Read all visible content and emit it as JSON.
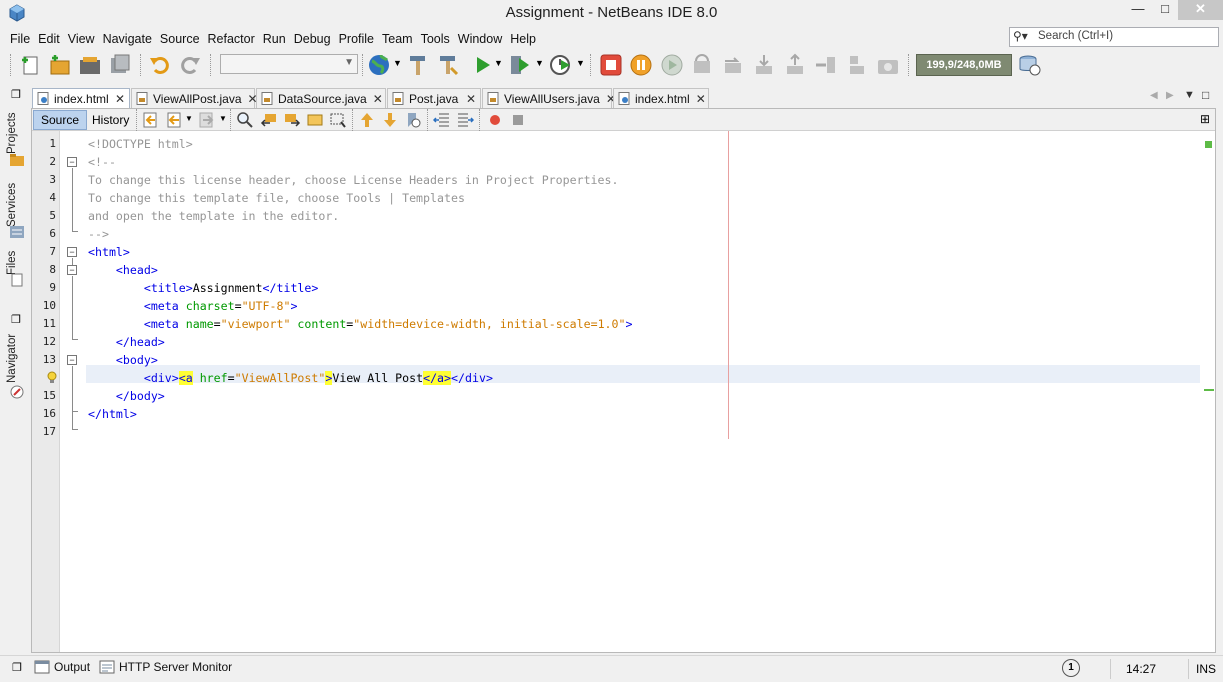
{
  "window": {
    "title": "Assignment - NetBeans IDE 8.0"
  },
  "menu": [
    "File",
    "Edit",
    "View",
    "Navigate",
    "Source",
    "Refactor",
    "Run",
    "Debug",
    "Profile",
    "Team",
    "Tools",
    "Window",
    "Help"
  ],
  "search": {
    "placeholder": "Search (Ctrl+I)"
  },
  "toolbar": {
    "memory": "199,9/248,0MB"
  },
  "sidebar": [
    "Projects",
    "Services",
    "Files",
    "Navigator"
  ],
  "tabs": [
    {
      "label": "index.html",
      "active": true
    },
    {
      "label": "ViewAllPost.java"
    },
    {
      "label": "DataSource.java"
    },
    {
      "label": "Post.java"
    },
    {
      "label": "ViewAllUsers.java"
    },
    {
      "label": "index.html"
    }
  ],
  "editor": {
    "source_label": "Source",
    "history_label": "History",
    "line_numbers": [
      "1",
      "2",
      "3",
      "4",
      "5",
      "6",
      "7",
      "8",
      "9",
      "10",
      "11",
      "12",
      "13",
      "14",
      "15",
      "16",
      "17"
    ],
    "lines": [
      "<!DOCTYPE html>",
      "<!--",
      "To change this license header, choose License Headers in Project Properties.",
      "To change this template file, choose Tools | Templates",
      "and open the template in the editor.",
      "-->",
      "<html>",
      "    <head>",
      "        <title>Assignment</title>",
      "        <meta charset=\"UTF-8\">",
      "        <meta name=\"viewport\" content=\"width=device-width, initial-scale=1.0\">",
      "    </head>",
      "    <body>",
      "        <div><a href=\"ViewAllPost\">View All Post</a></div>",
      "    </body>",
      "</html>",
      ""
    ]
  },
  "bottom": {
    "output": "Output",
    "http_monitor": "HTTP Server Monitor",
    "notifications": "1",
    "time": "14:27",
    "mode": "INS"
  },
  "colors": {
    "tag": "#0000e6",
    "attribute": "#009900",
    "value": "#ce7b00",
    "comment": "#969696",
    "highlight": "#ffff33",
    "current_line": "#e9eff8"
  }
}
